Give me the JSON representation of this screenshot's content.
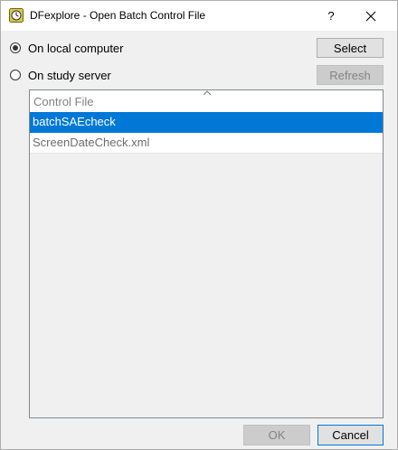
{
  "window": {
    "title": "DFexplore - Open Batch Control File",
    "help_glyph": "?",
    "close_icon": "close-icon",
    "app_icon": "dfexplore-app-icon"
  },
  "source": {
    "local_label": "On local computer",
    "server_label": "On study server",
    "selected": "local"
  },
  "buttons": {
    "select_label": "Select",
    "refresh_label": "Refresh",
    "ok_label": "OK",
    "cancel_label": "Cancel"
  },
  "file_list": {
    "column_header": "Control File",
    "sort": "ascending",
    "items": [
      {
        "name": "batchSAEcheck",
        "selected": true
      },
      {
        "name": "ScreenDateCheck.xml",
        "selected": false
      }
    ]
  },
  "colors": {
    "selection": "#0078d7",
    "dialog_bg": "#f0f0f0",
    "disabled_text": "#838383"
  }
}
